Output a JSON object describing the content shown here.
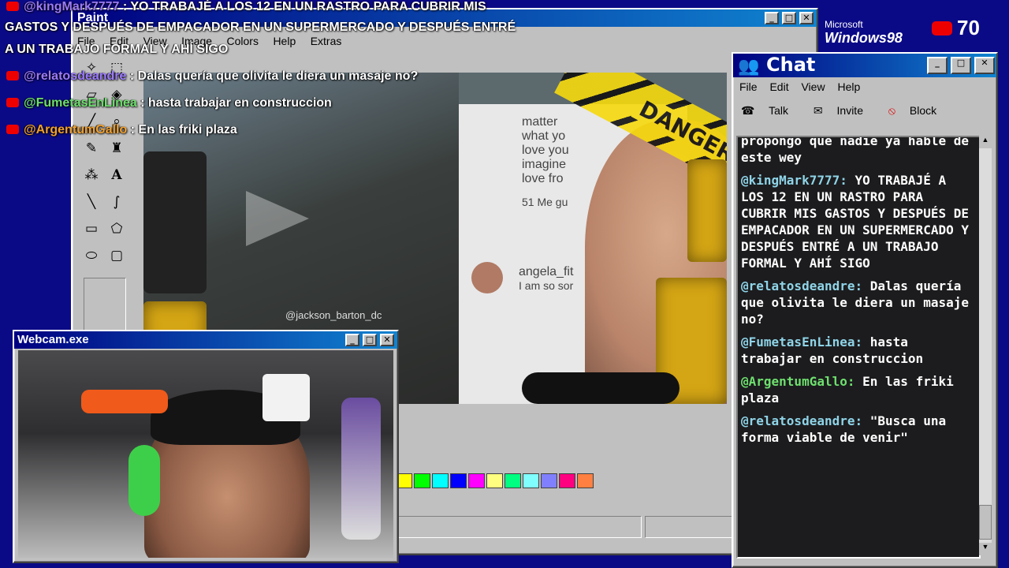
{
  "paint": {
    "title": "Paint",
    "menu": [
      "File",
      "Edit",
      "View",
      "Image",
      "Colors",
      "Help",
      "Extras"
    ],
    "palette": [
      "#ffff00",
      "#00ff00",
      "#00ffff",
      "#0000ff",
      "#ff00ff",
      "#ffff80",
      "#00ff80",
      "#80ffff",
      "#8080ff",
      "#ff0080",
      "#ff8040"
    ]
  },
  "video": {
    "danger_text": "DANGER",
    "watermark": "@jackson_barton_dc",
    "post_lines": [
      "matter",
      "what yo",
      "love you",
      "imagine",
      "love fro"
    ],
    "post_likes": "51 Me gu",
    "post_user": "angela_fit",
    "post_reply": "I am so sor"
  },
  "overlay": {
    "lines": [
      {
        "user": "@kingMark7777",
        "text": ": YO TRABAJÉ A LOS 12 EN UN RASTRO PARA CUBRIR MIS"
      },
      {
        "user": "",
        "text": "GASTOS Y DESPUÉS DE EMPACADOR EN UN SUPERMERCADO Y DESPUÉS ENTRÉ"
      },
      {
        "user": "",
        "text": "A UN TRABAJO FORMAL Y AHÍ SIGO"
      },
      {
        "user": "@relatosdeandre",
        "text": ": Dalas quería que olivita le diera un masaje no?"
      },
      {
        "user": "@FumetasEnLinea",
        "text": ": hasta trabajar en construccion"
      },
      {
        "user": "@ArgentumGallo",
        "text": ": En las friki plaza"
      }
    ]
  },
  "branding": {
    "ms": "Microsoft",
    "windows": "Windows98"
  },
  "viewers": "70",
  "webcam": {
    "title": "Webcam.exe"
  },
  "chat": {
    "title": "Chat",
    "menu": [
      "File",
      "Edit",
      "View",
      "Help"
    ],
    "tools": [
      "Talk",
      "Invite",
      "Block"
    ],
    "messages": [
      {
        "user": "",
        "text": "propongo que nadie ya hablé de este wey"
      },
      {
        "user": "@kingMark7777:",
        "text": "YO TRABAJÉ A LOS 12 EN UN RASTRO PARA CUBRIR MIS GASTOS Y DESPUÉS DE EMPACADOR EN UN SUPERMERCADO Y DESPUÉS ENTRÉ A UN TRABAJO FORMAL Y AHÍ SIGO"
      },
      {
        "user": "@relatosdeandre:",
        "text": "Dalas quería que olivita le diera un masaje no?"
      },
      {
        "user": "@FumetasEnLinea:",
        "text": "hasta trabajar en construccion"
      },
      {
        "user": "@ArgentumGallo:",
        "text": "En las friki plaza"
      },
      {
        "user": "@relatosdeandre:",
        "text": "\"Busca una forma viable de venir\""
      }
    ]
  }
}
